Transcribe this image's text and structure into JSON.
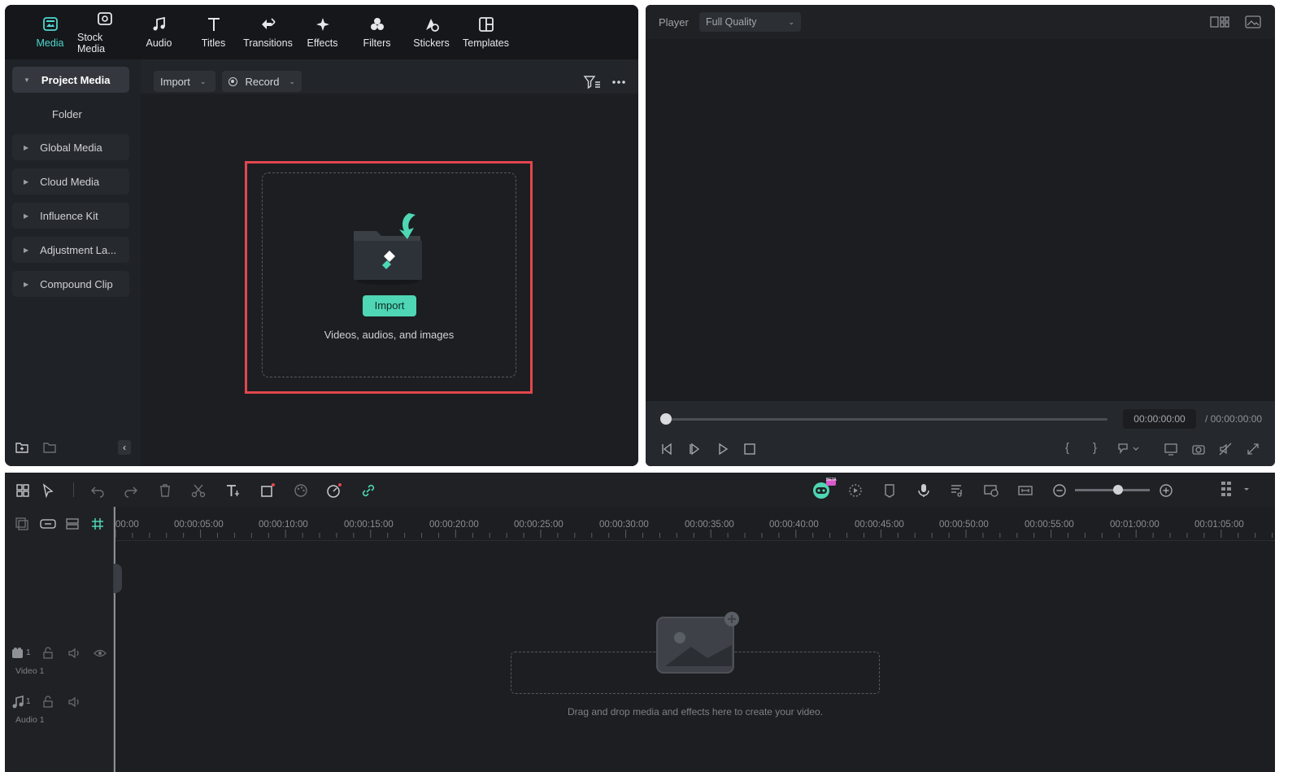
{
  "nav": {
    "tabs": [
      {
        "label": "Media",
        "icon": "media-icon",
        "active": true
      },
      {
        "label": "Stock Media",
        "icon": "stock-media-icon"
      },
      {
        "label": "Audio",
        "icon": "music-note-icon"
      },
      {
        "label": "Titles",
        "icon": "text-t-icon"
      },
      {
        "label": "Transitions",
        "icon": "transition-arrows-icon"
      },
      {
        "label": "Effects",
        "icon": "sparkle-star-icon"
      },
      {
        "label": "Filters",
        "icon": "filter-circles-icon"
      },
      {
        "label": "Stickers",
        "icon": "sticker-icon"
      },
      {
        "label": "Templates",
        "icon": "template-grid-icon"
      }
    ]
  },
  "sidebar": {
    "project_media": "Project Media",
    "folder": "Folder",
    "items": [
      "Global Media",
      "Cloud Media",
      "Influence Kit",
      "Adjustment La...",
      "Compound Clip"
    ]
  },
  "toolbar": {
    "import_label": "Import",
    "record_label": "Record"
  },
  "dropzone": {
    "import_button": "Import",
    "hint": "Videos, audios, and images"
  },
  "player": {
    "label": "Player",
    "quality": "Full Quality",
    "time_current": "00:00:00:00",
    "time_total": "/ 00:00:00:00"
  },
  "timeline": {
    "ruler": [
      "00:00",
      "00:00:05:00",
      "00:00:10:00",
      "00:00:15:00",
      "00:00:20:00",
      "00:00:25:00",
      "00:00:30:00",
      "00:00:35:00",
      "00:00:40:00",
      "00:00:45:00",
      "00:00:50:00",
      "00:00:55:00",
      "00:01:00:00",
      "00:01:05:00"
    ],
    "video_track": "Video 1",
    "audio_track": "Audio 1",
    "video_track_num": "1",
    "audio_track_num": "1",
    "hint": "Drag and drop media and effects here to create your video.",
    "beta_badge": "BETA"
  },
  "colors": {
    "accent": "#4fd6d0",
    "import_button": "#4fd6b4",
    "highlight_border": "#e2474e"
  }
}
